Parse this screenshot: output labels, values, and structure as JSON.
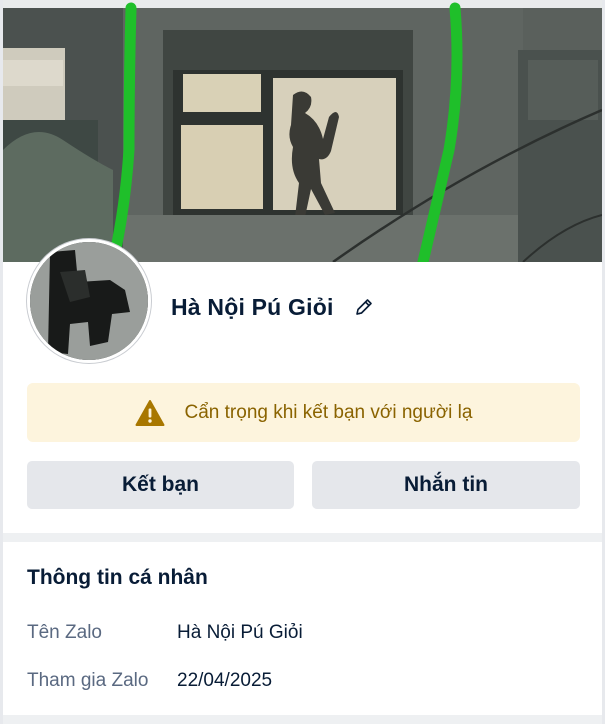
{
  "profile": {
    "name": "Hà Nội Pú Giỏi",
    "edit_icon": "pencil-icon"
  },
  "warning": {
    "icon": "warning-triangle-icon",
    "text": "Cẩn trọng khi kết bạn với người lạ",
    "color": "#8a6300",
    "background": "#fdf4dd"
  },
  "actions": {
    "add_friend_label": "Kết bạn",
    "message_label": "Nhắn tin"
  },
  "personal_info": {
    "title": "Thông tin cá nhân",
    "rows": [
      {
        "label": "Tên Zalo",
        "value": "Hà Nội Pú Giỏi"
      },
      {
        "label": "Tham gia Zalo",
        "value": "22/04/2025"
      }
    ]
  },
  "colors": {
    "text_primary": "#081c36",
    "text_secondary": "#5a6981",
    "button_bg": "#e5e7eb"
  }
}
